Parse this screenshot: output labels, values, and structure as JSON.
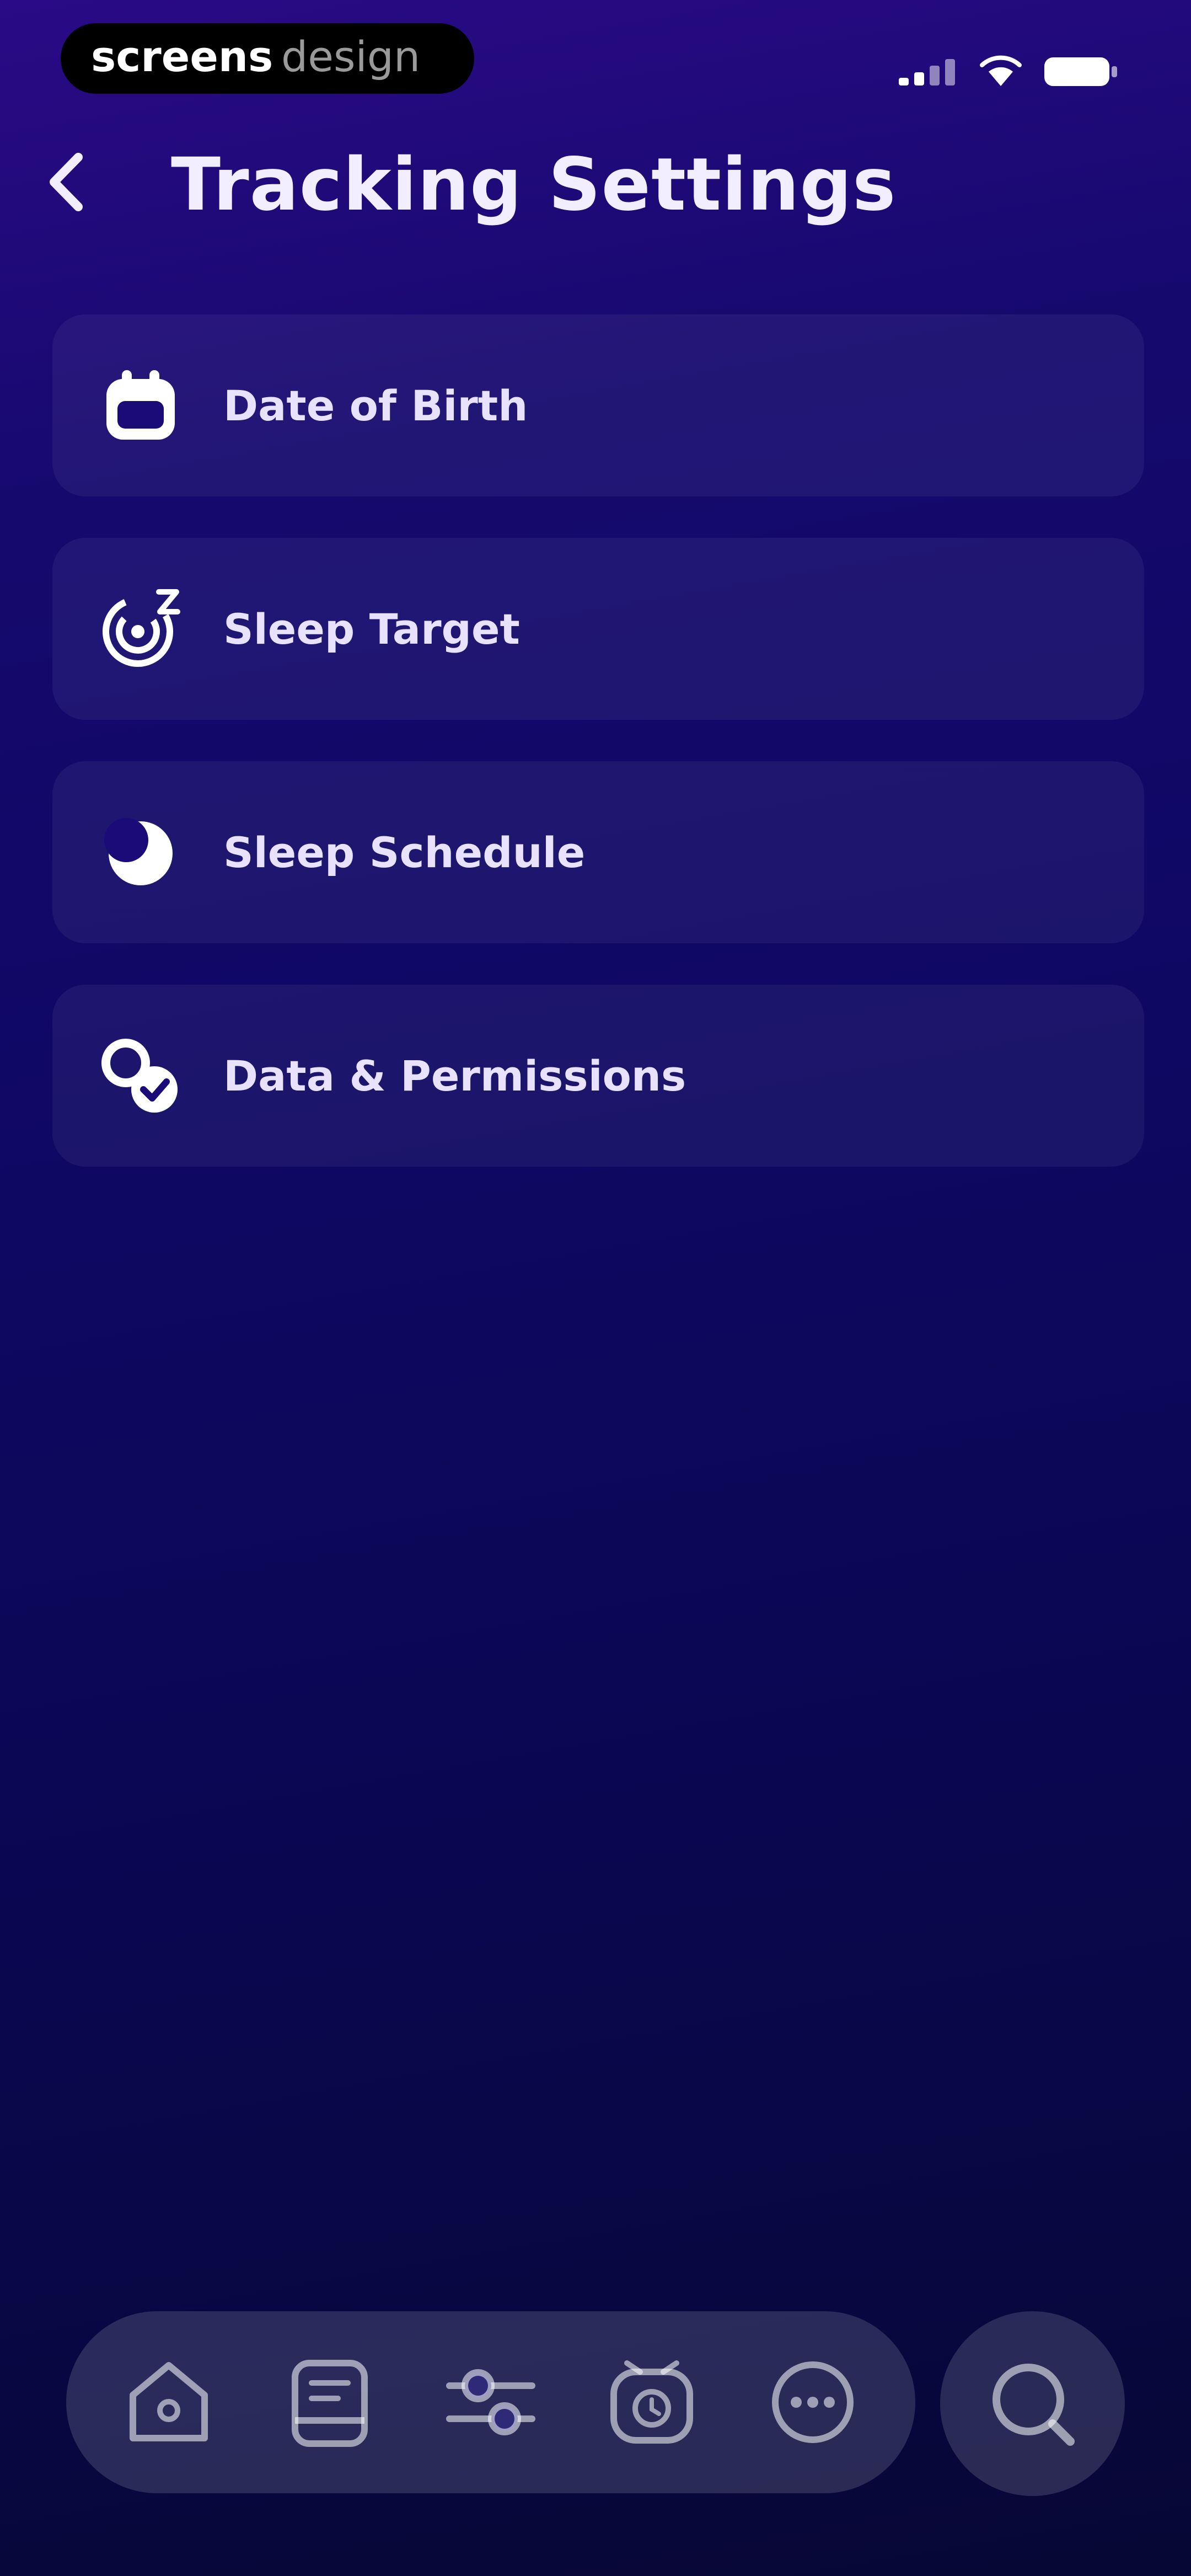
{
  "watermark": {
    "text_bold": "screens",
    "text_light": "design"
  },
  "status_bar": {
    "icons": [
      "cellular-signal-icon",
      "wifi-icon",
      "battery-icon"
    ]
  },
  "header": {
    "back_icon": "chevron-left-icon",
    "title": "Tracking Settings"
  },
  "settings": [
    {
      "id": "date-of-birth",
      "label": "Date of Birth",
      "icon": "calendar-icon"
    },
    {
      "id": "sleep-target",
      "label": "Sleep Target",
      "icon": "sleep-target-icon"
    },
    {
      "id": "sleep-schedule",
      "label": "Sleep Schedule",
      "icon": "moon-icon"
    },
    {
      "id": "data-permissions",
      "label": "Data & Permissions",
      "icon": "permissions-icon"
    }
  ],
  "tab_bar": {
    "items": [
      {
        "id": "home",
        "icon": "home-icon"
      },
      {
        "id": "journal",
        "icon": "journal-icon"
      },
      {
        "id": "adjust",
        "icon": "sliders-icon"
      },
      {
        "id": "alarm",
        "icon": "alarm-clock-icon"
      },
      {
        "id": "more",
        "icon": "more-icon"
      }
    ],
    "search_icon": "search-icon"
  },
  "colors": {
    "background_top": "#2a0a86",
    "background_bottom": "#070735",
    "card": "rgba(255,255,255,0.055)",
    "tab_bar": "rgba(255,255,255,0.14)",
    "text": "#e8e2ff"
  }
}
